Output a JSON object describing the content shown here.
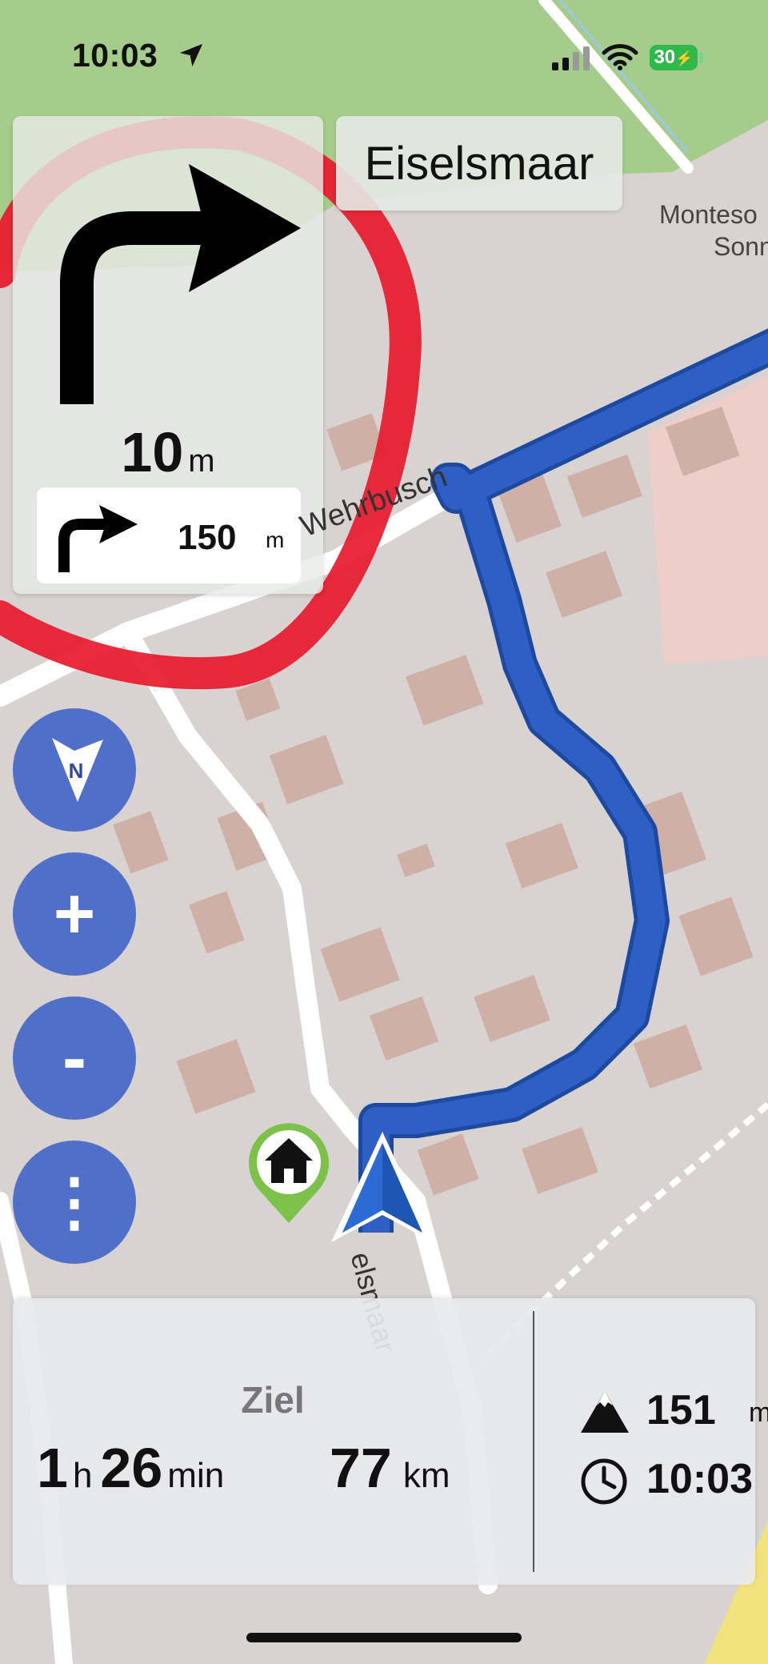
{
  "status_bar": {
    "time": "10:03",
    "battery": "30"
  },
  "navigation": {
    "next_distance_value": "10",
    "next_distance_unit": "m",
    "following_distance_value": "150",
    "following_distance_unit": "m",
    "street_name": "Eiselsmaar",
    "turn_direction": "right-arrow-icon"
  },
  "map": {
    "labels": {
      "wehrbusch": "Wehrbusch",
      "monteso": "Monteso",
      "sonn": "Sonn",
      "eiselsmaar_road": "elsmaar"
    },
    "colors": {
      "route": "#2e5fc4",
      "annotation_circle": "#e8192c",
      "park": "#a6cc8c",
      "buildings": "#cfaea6"
    }
  },
  "controls": {
    "compass_label": "N",
    "zoom_in": "+",
    "zoom_out": "-",
    "more": "⋮"
  },
  "trip_summary": {
    "destination_label": "Ziel",
    "eta_hours": "1",
    "eta_hours_unit": "h",
    "eta_minutes": "26",
    "eta_minutes_unit": "min",
    "remaining_distance": "77",
    "remaining_distance_unit": "km",
    "elevation_value": "151",
    "elevation_unit": "m",
    "clock": "10:03"
  }
}
